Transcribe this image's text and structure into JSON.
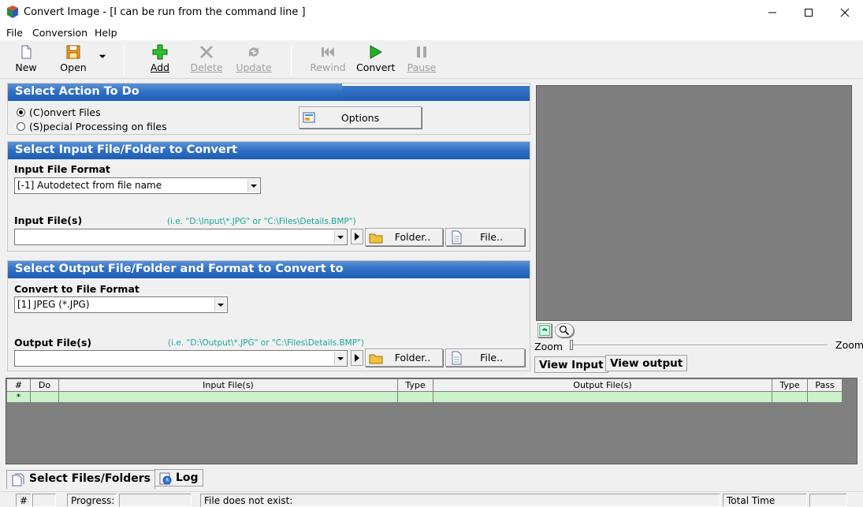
{
  "window": {
    "title": "Convert Image - [I can be run from the command line ]"
  },
  "menu": [
    "File",
    "Conversion",
    "Help"
  ],
  "toolbar": {
    "new": "New",
    "open": "Open",
    "add": "Add",
    "delete": "Delete",
    "update": "Update",
    "rewind": "Rewind",
    "convert": "Convert",
    "pause": "Pause"
  },
  "action": {
    "heading": "Select Action To Do",
    "convert_files": "(C)onvert Files",
    "special_processing": "(S)pecial Processing on files",
    "options": "Options"
  },
  "input": {
    "heading": "Select Input File/Folder to Convert",
    "format_label": "Input File Format",
    "format_value": "[-1] Autodetect from file name",
    "files_label": "Input File(s)",
    "hint": "(i.e. \"D:\\Input\\*.JPG\"  or  \"C:\\Files\\Details.BMP\")",
    "files_value": "",
    "folder": "Folder..",
    "file": "File.."
  },
  "output": {
    "heading": "Select Output File/Folder and Format to Convert to",
    "format_label": "Convert to File Format",
    "format_value": "[1] JPEG (*.JPG)",
    "files_label": "Output File(s)",
    "hint": "(i.e. \"D:\\Output\\*.JPG\"  or  \"C:\\Files\\Details.BMP\")",
    "files_value": "",
    "folder": "Folder..",
    "file": "File.."
  },
  "preview": {
    "zoom_left": "Zoom",
    "zoom_right": "Zoom",
    "view_input": "View Input",
    "view_output": "View output"
  },
  "grid": {
    "columns": [
      "#",
      "Do",
      "Input File(s)",
      "Type",
      "Output File(s)",
      "Type",
      "Pass"
    ],
    "new_row_marker": "*"
  },
  "tabs": {
    "select_files": "Select Files/Folders",
    "log": "Log"
  },
  "status": {
    "hash": "#",
    "progress": "Progress:",
    "message": "File does not exist:",
    "total_time": "Total Time (Sec):"
  },
  "colors": {
    "heading_blue": "#1e5db4",
    "grid_row": "#ccf2cc",
    "hint_teal": "#1aa89c"
  }
}
